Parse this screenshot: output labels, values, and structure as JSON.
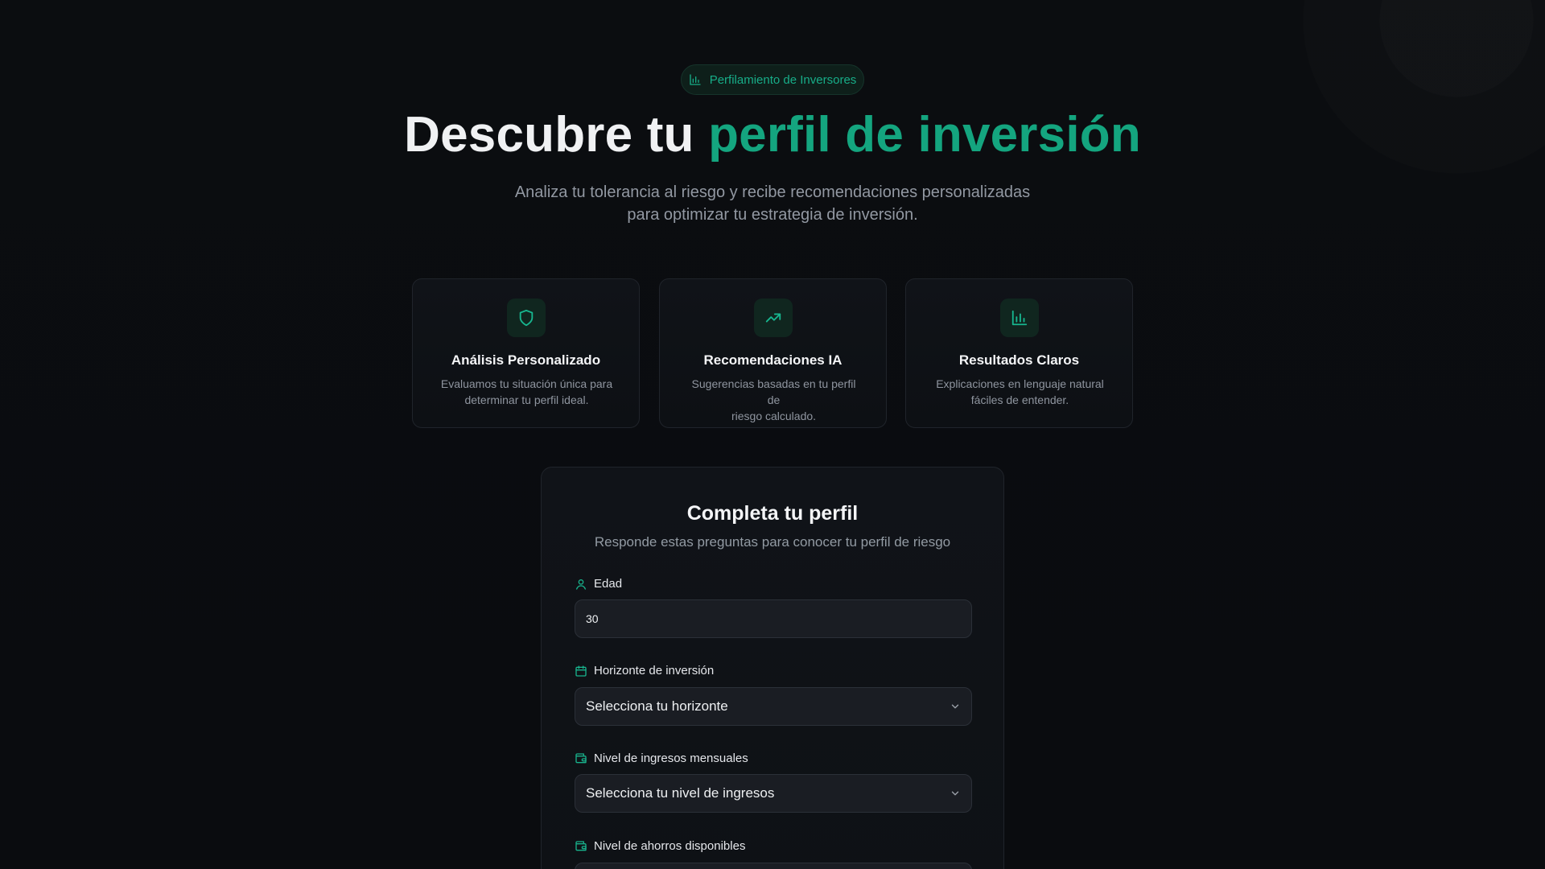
{
  "badge": {
    "text": "Perfilamiento de Inversores",
    "icon": "bar-chart-icon"
  },
  "hero": {
    "title_prefix": "Descubre tu ",
    "title_accent": "perfil de inversión",
    "subtitle_line1": "Analiza tu tolerancia al riesgo y recibe recomendaciones personalizadas",
    "subtitle_line2": "para optimizar tu estrategia de inversión."
  },
  "features": [
    {
      "icon": "shield-icon",
      "title": "Análisis Personalizado",
      "description_line1": "Evaluamos tu situación única para",
      "description_line2": "determinar tu perfil ideal."
    },
    {
      "icon": "trend-up-icon",
      "title": "Recomendaciones IA",
      "description_line1": "Sugerencias basadas en tu perfil de",
      "description_line2": "riesgo calculado."
    },
    {
      "icon": "bar-chart-icon",
      "title": "Resultados Claros",
      "description_line1": "Explicaciones en lenguaje natural",
      "description_line2": "fáciles de entender."
    }
  ],
  "form": {
    "title": "Completa tu perfil",
    "subtitle": "Responde estas preguntas para conocer tu perfil de riesgo",
    "fields": {
      "age": {
        "label": "Edad",
        "value": "30",
        "icon": "user-icon"
      },
      "horizon": {
        "label": "Horizonte de inversión",
        "placeholder": "Selecciona tu horizonte",
        "icon": "calendar-icon"
      },
      "income": {
        "label": "Nivel de ingresos mensuales",
        "placeholder": "Selecciona tu nivel de ingresos",
        "icon": "wallet-icon"
      },
      "savings": {
        "label": "Nivel de ahorros disponibles",
        "icon": "wallet-icon"
      }
    }
  },
  "colors": {
    "background": "#0b0d10",
    "accent": "#14a57f",
    "card": "#101318",
    "input": "#1a1d23",
    "muted_text": "#929aa3"
  }
}
